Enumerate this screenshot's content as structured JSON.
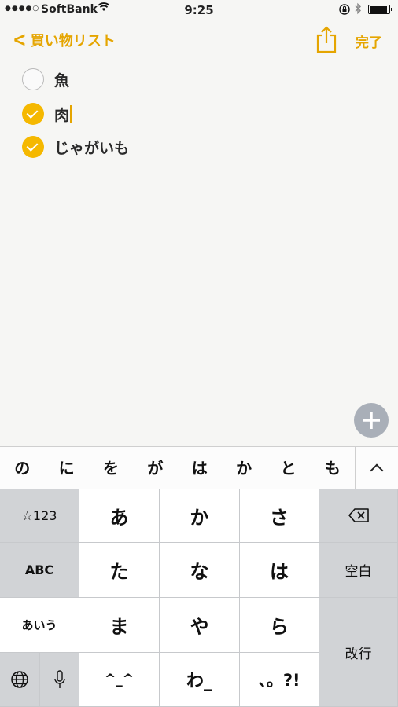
{
  "status_bar": {
    "signal_dots": "●●●●○",
    "carrier": "SoftBank",
    "time": "9:25",
    "icons": [
      "wifi-icon",
      "orientation-lock-icon",
      "bluetooth-icon",
      "battery-icon"
    ]
  },
  "nav": {
    "back_label": "買い物リスト",
    "done_label": "完了",
    "accent_color": "#e5a500"
  },
  "checklist": [
    {
      "text": "魚",
      "checked": false
    },
    {
      "text": "肉",
      "checked": true
    },
    {
      "text": "じゃがいも",
      "checked": true
    }
  ],
  "predictive": [
    "の",
    "に",
    "を",
    "が",
    "は",
    "か",
    "と",
    "も"
  ],
  "keyboard": {
    "symbols_key": "☆123",
    "abc_key": "ABC",
    "kana_key": "あいう",
    "space_key": "空白",
    "return_key": "改行",
    "rows": [
      [
        "あ",
        "か",
        "さ"
      ],
      [
        "た",
        "な",
        "は"
      ],
      [
        "ま",
        "や",
        "ら"
      ],
      [
        "^_^",
        "わ_",
        "、。?!"
      ]
    ]
  }
}
